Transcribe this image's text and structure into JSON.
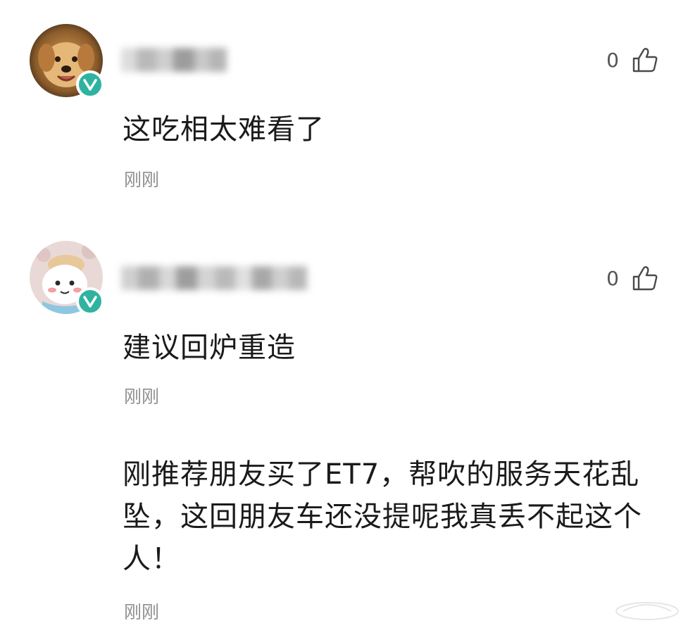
{
  "comments": [
    {
      "username": "",
      "like_count": "0",
      "text": "这吃相太难看了",
      "time": "刚刚"
    },
    {
      "username": "",
      "like_count": "0",
      "text": "建议回炉重造",
      "time": "刚刚"
    },
    {
      "text_line1": "刚推荐朋友买了ET7，帮吹的服务天花乱",
      "text_line2": "坠，这回朋友车还没提呢我真丢不起这个",
      "text_line3": "人！",
      "time": "刚刚"
    }
  ],
  "icons": {
    "like": "thumbs-up-icon",
    "verified": "verified-v-icon"
  },
  "colors": {
    "verified_badge": "#2fb3a0",
    "time_text": "#8f8f8f",
    "like_text": "#555555"
  }
}
